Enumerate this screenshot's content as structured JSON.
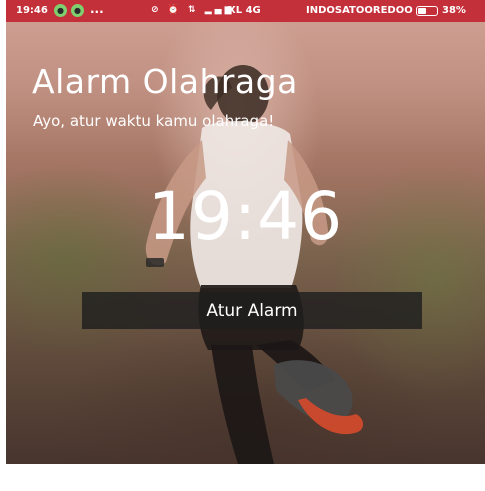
{
  "status_bar": {
    "time": "19:46",
    "more_indicator": "...",
    "network": "XL 4G",
    "carrier": "INDOSATOOREDOO",
    "battery_percent": "38%",
    "battery_level": 0.38,
    "notification_icons": [
      "chat-icon",
      "chat-icon"
    ],
    "system_icons": [
      "mute-icon",
      "alarm-icon",
      "data-transfer-icon",
      "signal-icon"
    ]
  },
  "header": {
    "title": "Alarm Olahraga",
    "subtitle": "Ayo, atur waktu kamu olahraga!"
  },
  "clock": {
    "time": "19:46"
  },
  "actions": {
    "set_alarm_label": "Atur Alarm"
  },
  "colors": {
    "status_bar": "#c4303a",
    "button_bg": "#1e1e1e",
    "text": "#ffffff"
  }
}
